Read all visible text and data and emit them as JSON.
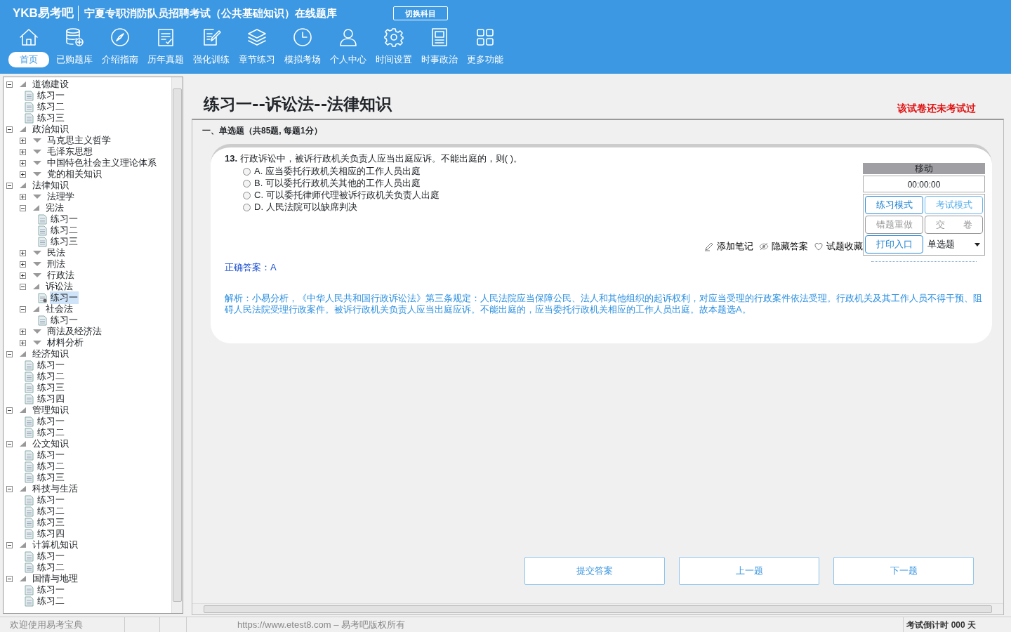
{
  "header": {
    "logo": "YKB易考吧",
    "title": "宁夏专职消防队员招聘考试（公共基础知识）在线题库",
    "switch_button": "切换科目"
  },
  "toolbar": [
    {
      "label": "首页",
      "selected": true
    },
    {
      "label": "已购题库",
      "selected": false
    },
    {
      "label": "介绍指南",
      "selected": false
    },
    {
      "label": "历年真题",
      "selected": false
    },
    {
      "label": "强化训练",
      "selected": false
    },
    {
      "label": "章节练习",
      "selected": false
    },
    {
      "label": "模拟考场",
      "selected": false
    },
    {
      "label": "个人中心",
      "selected": false
    },
    {
      "label": "时间设置",
      "selected": false
    },
    {
      "label": "时事政治",
      "selected": false
    },
    {
      "label": "更多功能",
      "selected": false
    }
  ],
  "tree": [
    {
      "label": "道德建设",
      "expanded": true,
      "children": [
        {
          "label": "练习一",
          "selected": false
        },
        {
          "label": "练习二",
          "selected": false
        },
        {
          "label": "练习三",
          "selected": false
        }
      ]
    },
    {
      "label": "政治知识",
      "expanded": true,
      "children": [
        {
          "label": "马克思主义哲学",
          "expanded": false
        },
        {
          "label": "毛泽东思想",
          "expanded": false
        },
        {
          "label": "中国特色社会主义理论体系",
          "expanded": false
        },
        {
          "label": "党的相关知识",
          "expanded": false
        }
      ]
    },
    {
      "label": "法律知识",
      "expanded": true,
      "children": [
        {
          "label": "法理学",
          "expanded": false
        },
        {
          "label": "宪法",
          "expanded": true,
          "children": [
            {
              "label": "练习一",
              "selected": false
            },
            {
              "label": "练习二",
              "selected": false
            },
            {
              "label": "练习三",
              "selected": false
            }
          ]
        },
        {
          "label": "民法",
          "expanded": false
        },
        {
          "label": "刑法",
          "expanded": false
        },
        {
          "label": "行政法",
          "expanded": false
        },
        {
          "label": "诉讼法",
          "expanded": true,
          "children": [
            {
              "label": "练习一",
              "selected": true
            }
          ]
        },
        {
          "label": "社会法",
          "expanded": true,
          "children": [
            {
              "label": "练习一",
              "selected": false
            }
          ]
        },
        {
          "label": "商法及经济法",
          "expanded": false
        },
        {
          "label": "材料分析",
          "expanded": false
        }
      ]
    },
    {
      "label": "经济知识",
      "expanded": true,
      "children": [
        {
          "label": "练习一",
          "selected": false
        },
        {
          "label": "练习二",
          "selected": false
        },
        {
          "label": "练习三",
          "selected": false
        },
        {
          "label": "练习四",
          "selected": false
        }
      ]
    },
    {
      "label": "管理知识",
      "expanded": true,
      "children": [
        {
          "label": "练习一",
          "selected": false
        },
        {
          "label": "练习二",
          "selected": false
        }
      ]
    },
    {
      "label": "公文知识",
      "expanded": true,
      "children": [
        {
          "label": "练习一",
          "selected": false
        },
        {
          "label": "练习二",
          "selected": false
        },
        {
          "label": "练习三",
          "selected": false
        }
      ]
    },
    {
      "label": "科技与生活",
      "expanded": true,
      "children": [
        {
          "label": "练习一",
          "selected": false
        },
        {
          "label": "练习二",
          "selected": false
        },
        {
          "label": "练习三",
          "selected": false
        },
        {
          "label": "练习四",
          "selected": false
        }
      ]
    },
    {
      "label": "计算机知识",
      "expanded": true,
      "children": [
        {
          "label": "练习一",
          "selected": false
        },
        {
          "label": "练习二",
          "selected": false
        }
      ]
    },
    {
      "label": "国情与地理",
      "expanded": true,
      "children": [
        {
          "label": "练习一",
          "selected": false
        },
        {
          "label": "练习二",
          "selected": false
        }
      ]
    }
  ],
  "exam": {
    "title": "练习一--诉讼法--法律知识",
    "status": "该试卷还未考试过",
    "section": "一、单选题（共85题, 每题1分）"
  },
  "question": {
    "number": "13.",
    "text": "行政诉讼中，被诉行政机关负责人应当出庭应诉。不能出庭的，则( )。",
    "options": [
      {
        "letter": "A.",
        "text": "应当委托行政机关相应的工作人员出庭",
        "checked": false
      },
      {
        "letter": "B.",
        "text": "可以委托行政机关其他的工作人员出庭",
        "checked": false
      },
      {
        "letter": "C.",
        "text": "可以委托律师代理被诉行政机关负责人出庭",
        "checked": false
      },
      {
        "letter": "D.",
        "text": "人民法院可以缺席判决",
        "checked": false
      }
    ],
    "tools": [
      "添加笔记",
      "隐藏答案",
      "试题收藏"
    ],
    "answer": "正确答案：A",
    "explanation": "解析：小易分析，《中华人民共和国行政诉讼法》第三条规定：人民法院应当保障公民、法人和其他组织的起诉权利，对应当受理的行政案件依法受理。行政机关及其工作人员不得干预、阻碍人民法院受理行政案件。被诉行政机关负责人应当出庭应诉。不能出庭的，应当委托行政机关相应的工作人员出庭。故本题选A。"
  },
  "control_panel": {
    "title": "移动",
    "timer": "00:00:00",
    "buttons": [
      {
        "label": "练习模式",
        "kind": "active"
      },
      {
        "label": "考试模式",
        "kind": "light"
      },
      {
        "label": "错题重做",
        "kind": "disabled"
      },
      {
        "label": "交　　卷",
        "kind": "disabled"
      },
      {
        "label": "打印入口",
        "kind": "active"
      }
    ],
    "select": {
      "value": "单选题"
    }
  },
  "nav_buttons": [
    "提交答案",
    "上一题",
    "下一题"
  ],
  "status_bar": {
    "welcome": "欢迎使用易考宝典",
    "copyright": "https://www.etest8.com – 易考吧版权所有",
    "countdown": "考试倒计时 000 天"
  }
}
